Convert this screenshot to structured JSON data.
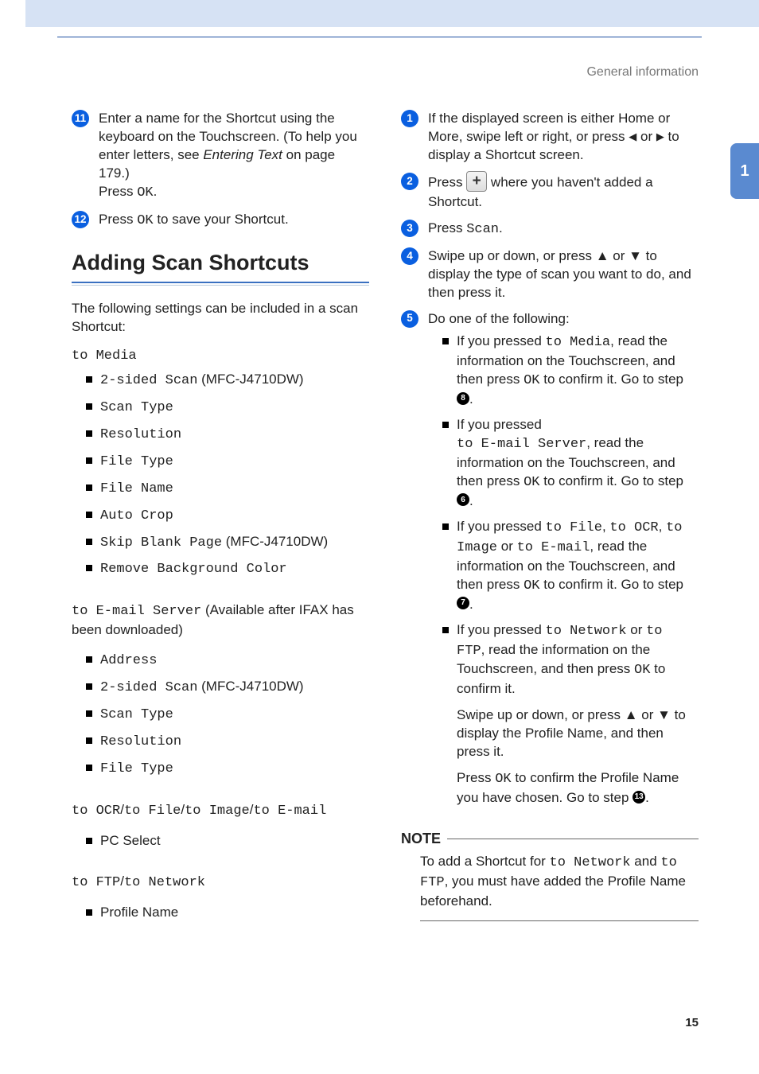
{
  "header": {
    "section": "General information",
    "chapter": "1"
  },
  "page_number": "15",
  "left": {
    "step11_a": "Enter a name for the Shortcut using the keyboard on the Touchscreen. (To help you enter letters, see ",
    "step11_link": "Entering Text",
    "step11_b": " on page 179.)",
    "step11_press": "Press ",
    "ok": "OK",
    "step11_c": ".",
    "step12_a": "Press ",
    "step12_b": " to save your Shortcut.",
    "h2": "Adding Scan Shortcuts",
    "intro": "The following settings can be included in a scan Shortcut:",
    "grp1_head": "to Media",
    "grp1_items": [
      {
        "text": "2-sided Scan",
        "suffix": " (MFC-J4710DW)",
        "mono": true
      },
      {
        "text": "Scan Type",
        "mono": true
      },
      {
        "text": "Resolution",
        "mono": true
      },
      {
        "text": "File Type",
        "mono": true
      },
      {
        "text": "File Name",
        "mono": true
      },
      {
        "text": "Auto Crop",
        "mono": true
      },
      {
        "text": "Skip Blank Page",
        "suffix": " (MFC-J4710DW)",
        "mono": true
      },
      {
        "text": "Remove Background Color",
        "mono": true
      }
    ],
    "grp2_head_a": "to E-mail Server",
    "grp2_head_b": " (Available after IFAX has been downloaded)",
    "grp2_items": [
      {
        "text": "Address",
        "mono": true
      },
      {
        "text": "2-sided Scan",
        "suffix": " (MFC-J4710DW)",
        "mono": true
      },
      {
        "text": "Scan Type",
        "mono": true
      },
      {
        "text": "Resolution",
        "mono": true
      },
      {
        "text": "File Type",
        "mono": true
      }
    ],
    "grp3_parts": [
      "to OCR",
      "/",
      "to File",
      "/",
      "to Image",
      "/",
      "to E-mail"
    ],
    "grp3_items": [
      {
        "text": "PC Select",
        "mono": false
      }
    ],
    "grp4_parts": [
      "to FTP",
      "/",
      "to Network"
    ],
    "grp4_items": [
      {
        "text": "Profile Name",
        "mono": false
      }
    ]
  },
  "right": {
    "step1_a": "If the displayed screen is either Home or More, swipe left or right, or press ",
    "step1_b": " or ",
    "step1_c": " to display a Shortcut screen.",
    "step2_a": "Press ",
    "step2_b": " where you haven't added a Shortcut.",
    "step3_a": "Press ",
    "step3_scan": "Scan",
    "step3_b": ".",
    "step4": "Swipe up or down, or press ▲ or ▼ to display the type of scan you want to do, and then press it.",
    "step5": "Do one of the following:",
    "b1_a": "If you pressed ",
    "b1_code": "to Media",
    "b1_b": ", read the information on the Touchscreen, and then press ",
    "b1_c": " to confirm it. Go to step ",
    "b1_ref": "8",
    "b2_a": "If you pressed ",
    "b2_code": "to E-mail Server",
    "b2_b": ", read the information on the Touchscreen, and then press ",
    "b2_c": " to confirm it. Go to step ",
    "b2_ref": "6",
    "b3_a": "If you pressed ",
    "b3_c1": "to File",
    "b3_c2": "to OCR",
    "b3_c3": "to Image",
    "b3_c4": "to E-mail",
    "b3_b": ", read the information on the Touchscreen, and then press ",
    "b3_d": " to confirm it. Go to step ",
    "b3_ref": "7",
    "b4_a": "If you pressed ",
    "b4_c1": "to Network",
    "b4_c2": "to FTP",
    "b4_b": ", read the information on the Touchscreen, and then press ",
    "b4_c": " to confirm it.",
    "b4_p2": "Swipe up or down, or press ▲ or ▼ to display the Profile Name, and then press it.",
    "b4_p3_a": "Press ",
    "b4_p3_b": " to confirm the Profile Name you have chosen. Go to step ",
    "b4_p3_ref": "13",
    "note_label": "NOTE",
    "note_a": "To add a Shortcut for ",
    "note_c1": "to Network",
    "note_mid": " and ",
    "note_c2": "to FTP",
    "note_b": ", you must have added the Profile Name beforehand."
  }
}
